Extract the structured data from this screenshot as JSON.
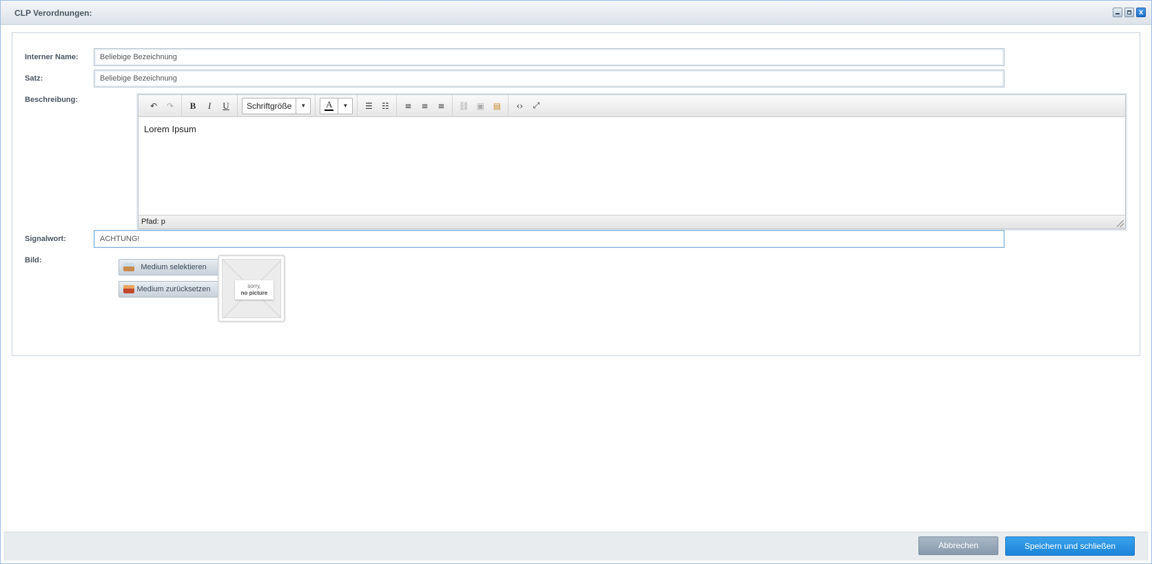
{
  "window": {
    "title": "CLP Verordnungen:",
    "close_glyph": "x"
  },
  "form": {
    "internal_name": {
      "label": "Interner Name:",
      "value": "Beliebige Bezeichnung"
    },
    "satz": {
      "label": "Satz:",
      "value": "Beliebige Bezeichnung"
    },
    "description": {
      "label": "Beschreibung:",
      "toolbar": {
        "font_size_label": "Schriftgröße",
        "bold": "B",
        "italic": "I",
        "underline": "U",
        "text_color": "A"
      },
      "content": "Lorem Ipsum",
      "status_path": "Pfad: p"
    },
    "signalwort": {
      "label": "Signalwort:",
      "value": "ACHTUNG!"
    },
    "bild": {
      "label": "Bild:",
      "select_button": "Medium selektieren",
      "reset_button": "Medium zurücksetzen",
      "placeholder_line1": "sorry,",
      "placeholder_line2": "no picture"
    }
  },
  "footer": {
    "cancel_label": "Abbrechen",
    "save_label": "Speichern und schließen"
  }
}
